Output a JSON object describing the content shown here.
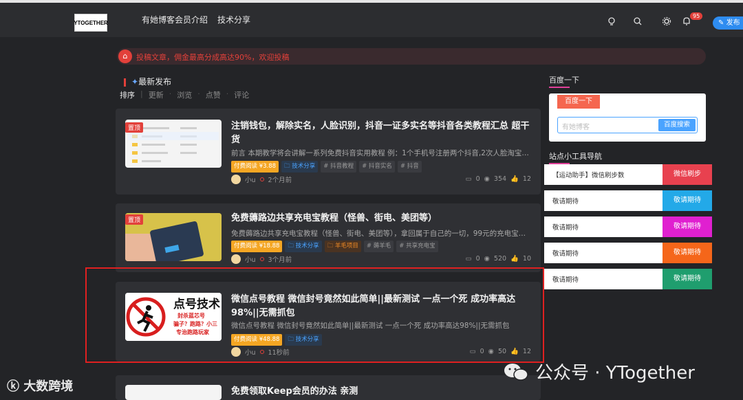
{
  "header": {
    "logo_text": "YTOGETHER",
    "nav": [
      "有她博客会员介绍",
      "技术分享"
    ],
    "notification_count": "95",
    "post_label": "发布"
  },
  "notice": {
    "text": "投稿文章，佣金最高分成高达90%，欢迎投稿"
  },
  "main": {
    "section_title": "最新发布",
    "tabs": [
      "排序",
      "更新",
      "浏览",
      "点赞",
      "评论"
    ]
  },
  "posts": [
    {
      "tag_top": "置顶",
      "title": "注销钱包，解除实名，人脸识别，抖音一证多实名等抖音各类教程汇总 超干货",
      "excerpt": "前言 本期教学将会讲解一系列免费抖音实用教程 例：1个手机号注册两个抖音,2次人脸淘宝28...",
      "tags": [
        "付费阅读 ¥3.88",
        "技术分享",
        "# 抖音教程",
        "# 抖音实名",
        "# 抖音"
      ],
      "author": "小u",
      "time": "2个月前",
      "comments": "0",
      "views": "354",
      "likes": "12"
    },
    {
      "tag_top": "置顶",
      "title": "免费薅路边共享充电宝教程（怪兽、街电、美团等）",
      "excerpt": "免费薅路边共享充电宝教程（怪兽、街电、美团等），拿回属于自己的一切，99元的充电宝，...",
      "tags": [
        "付费阅读 ¥18.88",
        "技术分享",
        "羊毛项目",
        "# 薅羊毛",
        "# 共享充电宝"
      ],
      "author": "小u",
      "time": "3个月前",
      "comments": "0",
      "views": "520",
      "likes": "10"
    },
    {
      "tag_top": "",
      "title": "微信点号教程 微信封号竟然如此简单||最新测试 一点一个死 成功率高达98%||无需抓包",
      "excerpt": "微信点号教程 微信封号竟然如此简单||最新测试 一点一个死 成功率高达98%||无需抓包",
      "tags": [
        "付费阅读 ¥48.88",
        "技术分享"
      ],
      "author": "小u",
      "time": "11秒前",
      "comments": "0",
      "views": "50",
      "likes": "12",
      "thumb_text": [
        "点号技术",
        "封杀蓝芯号",
        "骗子？跑路？小三",
        "专治跑路玩家"
      ]
    },
    {
      "title": "免费领取Keep会员的办法 亲测"
    }
  ],
  "sidebar": {
    "baidu_title": "百度一下",
    "baidu_tab": "百度一下",
    "baidu_placeholder": "有她博客",
    "baidu_button": "百度搜索",
    "tools_title": "站点小工具导航",
    "tools": [
      {
        "label": "【运动助手】微信刷步数",
        "action": "微信刷步",
        "color": "#e8414f"
      },
      {
        "label": "敬请期待",
        "action": "敬请期待",
        "color": "#23a9e8"
      },
      {
        "label": "敬请期待",
        "action": "敬请期待",
        "color": "#e020d0"
      },
      {
        "label": "敬请期待",
        "action": "敬请期待",
        "color": "#f5661a"
      },
      {
        "label": "敬请期待",
        "action": "敬请期待",
        "color": "#1f9e6e"
      }
    ]
  },
  "watermarks": {
    "left": "大数跨境",
    "right": "公众号 · YTogether"
  }
}
